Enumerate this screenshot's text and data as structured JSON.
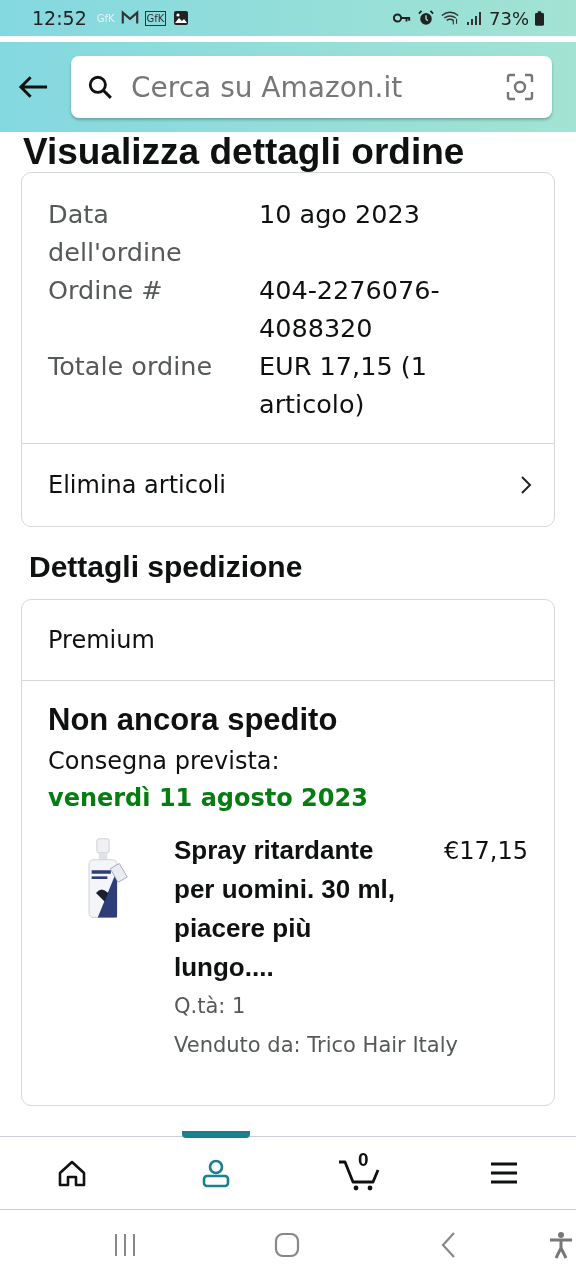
{
  "status_bar": {
    "time": "12:52",
    "notif_labels": [
      "GfK",
      "GfK"
    ],
    "battery": "73%"
  },
  "header": {
    "search_placeholder": "Cerca su Amazon.it"
  },
  "title": "Visualizza dettagli ordine",
  "order_summary": {
    "rows": [
      {
        "label": "Data dell'ordine",
        "value": "10 ago 2023"
      },
      {
        "label": "Ordine #",
        "value": "404-2276076-4088320"
      },
      {
        "label": "Totale ordine",
        "value": "EUR 17,15 (1 articolo)"
      }
    ],
    "action": "Elimina articoli"
  },
  "shipping": {
    "heading": "Dettagli spedizione",
    "type": "Premium",
    "status": "Non ancora spedito",
    "delivery_label": "Consegna prevista:",
    "delivery_date": "venerdì 11 agosto 2023",
    "item": {
      "kind": "picture",
      "name": "Spray ritardante per uomini. 30 ml, piacere più lungo....",
      "price": "€17,15",
      "quantity": "Q.tà: 1",
      "seller": "Venduto da: Trico Hair Italy"
    }
  },
  "bottom_nav": [
    {
      "kind": "home",
      "selected": false
    },
    {
      "kind": "account",
      "selected": true
    },
    {
      "kind": "cart",
      "selected": false,
      "count": "0"
    },
    {
      "kind": "menu",
      "selected": false
    }
  ]
}
